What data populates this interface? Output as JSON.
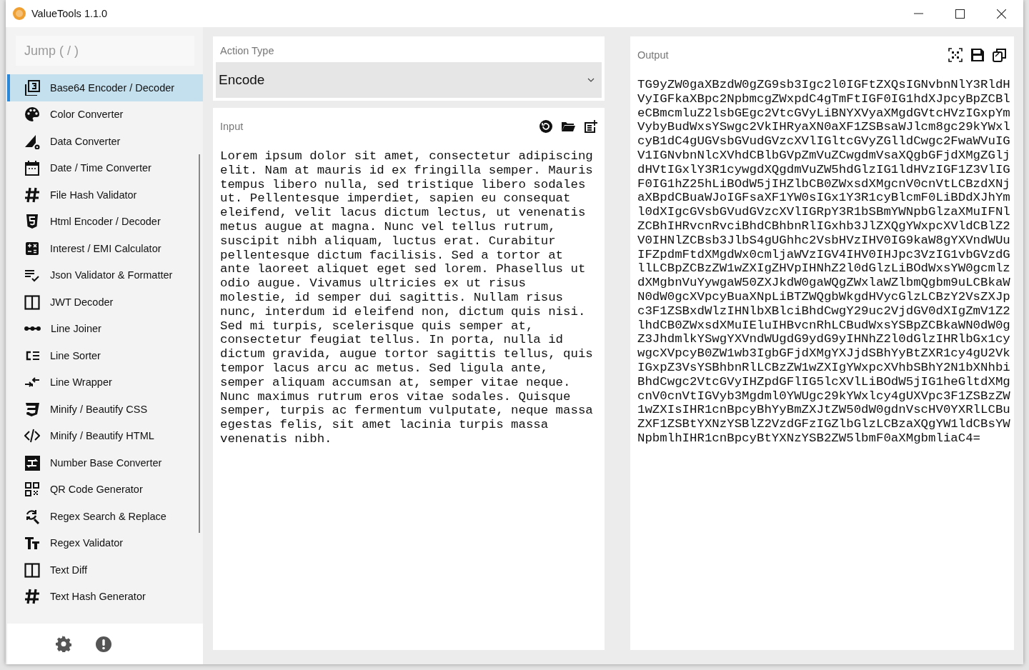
{
  "window": {
    "title": "ValueTools 1.1.0"
  },
  "sidebar": {
    "search_placeholder": "Jump ( / )",
    "items": [
      {
        "label": "Base64 Encoder / Decoder",
        "selected": true
      },
      {
        "label": "Color Converter",
        "selected": false
      },
      {
        "label": "Data Converter",
        "selected": false
      },
      {
        "label": "Date / Time Converter",
        "selected": false
      },
      {
        "label": "File Hash Validator",
        "selected": false
      },
      {
        "label": "Html Encoder / Decoder",
        "selected": false
      },
      {
        "label": "Interest / EMI Calculator",
        "selected": false
      },
      {
        "label": "Json Validator & Formatter",
        "selected": false
      },
      {
        "label": "JWT Decoder",
        "selected": false
      },
      {
        "label": "Line Joiner",
        "selected": false
      },
      {
        "label": "Line Sorter",
        "selected": false
      },
      {
        "label": "Line Wrapper",
        "selected": false
      },
      {
        "label": "Minify / Beautify CSS",
        "selected": false
      },
      {
        "label": "Minify / Beautify HTML",
        "selected": false
      },
      {
        "label": "Number Base Converter",
        "selected": false
      },
      {
        "label": "QR Code Generator",
        "selected": false
      },
      {
        "label": "Regex Search & Replace",
        "selected": false
      },
      {
        "label": "Regex Validator",
        "selected": false
      },
      {
        "label": "Text Diff",
        "selected": false
      },
      {
        "label": "Text Hash Generator",
        "selected": false
      }
    ]
  },
  "action_type": {
    "label": "Action Type",
    "value": "Encode"
  },
  "input": {
    "label": "Input",
    "lines": [
      "Lorem ipsum dolor sit amet, consectetur adipiscing",
      "elit. Nam at mauris id ex fringilla semper. Mauris",
      "tempus libero nulla, sed tristique libero sodales",
      "ut. Pellentesque imperdiet, sapien eu consequat",
      "eleifend, velit lacus dictum lectus, ut venenatis",
      "metus augue at magna. Nunc vel tellus rutrum,",
      "suscipit nibh aliquam, luctus erat. Curabitur",
      "pellentesque dictum facilisis. Sed a tortor at",
      "ante laoreet aliquet eget sed lorem. Phasellus ut",
      "odio augue. Vivamus ultricies ex ut risus",
      "molestie, id semper dui sagittis. Nullam risus",
      "nunc, interdum id eleifend non, dictum quis nisi.",
      "Sed mi turpis, scelerisque quis semper at,",
      "consectetur feugiat tellus. In porta, nulla id",
      "dictum gravida, augue tortor sagittis tellus, quis",
      "tempor lacus arcu ac metus. Sed ligula ante,",
      "semper aliquam accumsan at, semper vitae neque.",
      "Nunc maximus rutrum eros vitae sodales. Quisque",
      "semper, turpis ac fermentum vulputate, neque massa",
      "egestas felis, sit amet lacinia turpis massa",
      "venenatis nibh."
    ]
  },
  "output": {
    "label": "Output",
    "lines": [
      "TG9yZW0gaXBzdW0gZG9sb3Igc2l0IGFtZXQsIGNvbnNlY3RldH",
      "VyIGFkaXBpc2NpbmcgZWxpdC4gTmFtIGF0IG1hdXJpcyBpZCBl",
      "eCBmcmluZ2lsbGEgc2VtcGVyLiBNYXVyaXMgdGVtcHVzIGxpYm",
      "VybyBudWxsYSwgc2VkIHRyaXN0aXF1ZSBsaWJlcm8gc29kYWxl",
      "cyB1dC4gUGVsbGVudGVzcXVlIGltcGVyZGlldCwgc2FwaWVuIG",
      "V1IGNvbnNlcXVhdCBlbGVpZmVuZCwgdmVsaXQgbGFjdXMgZGlj",
      "dHVtIGxlY3R1cywgdXQgdmVuZW5hdGlzIG1ldHVzIGF1Z3VlIG",
      "F0IG1hZ25hLiBOdW5jIHZlbCB0ZWxsdXMgcnV0cnVtLCBzdXNj",
      "aXBpdCBuaWJoIGFsaXF1YW0sIGx1Y3R1cyBlcmF0LiBDdXJhYm",
      "l0dXIgcGVsbGVudGVzcXVlIGRpY3R1bSBmYWNpbGlzaXMuIFNl",
      "ZCBhIHRvcnRvciBhdCBhbnRlIGxhb3JlZXQgYWxpcXVldCBlZ2",
      "V0IHNlZCBsb3JlbS4gUGhhc2VsbHVzIHV0IG9kaW8gYXVndWUu",
      "IFZpdmFtdXMgdWx0cmljaWVzIGV4IHV0IHJpc3VzIG1vbGVzdG",
      "llLCBpZCBzZW1wZXIgZHVpIHNhZ2l0dGlzLiBOdWxsYW0gcmlz",
      "dXMgbnVuYywgaW50ZXJkdW0gaWQgZWxlaWZlbmQgbm9uLCBkaW",
      "N0dW0gcXVpcyBuaXNpLiBTZWQgbWkgdHVycGlzLCBzY2VsZXJp",
      "c3F1ZSBxdWlzIHNlbXBlciBhdCwgY29uc2VjdGV0dXIgZmV1Z2",
      "lhdCB0ZWxsdXMuIEluIHBvcnRhLCBudWxsYSBpZCBkaWN0dW0g",
      "Z3JhdmlkYSwgYXVndWUgdG9ydG9yIHNhZ2l0dGlzIHRlbGx1cy",
      "wgcXVpcyB0ZW1wb3IgbGFjdXMgYXJjdSBhYyBtZXR1cy4gU2Vk",
      "IGxpZ3VsYSBhbnRlLCBzZW1wZXIgYWxpcXVhbSBhY2N1bXNhbi",
      "BhdCwgc2VtcGVyIHZpdGFlIG5lcXVlLiBOdW5jIG1heGltdXMg",
      "cnV0cnVtIGVyb3Mgdml0YWUgc29kYWxlcy4gUXVpc3F1ZSBzZW",
      "1wZXIsIHR1cnBpcyBhYyBmZXJtZW50dW0gdnVscHV0YXRlLCBu",
      "ZXF1ZSBtYXNzYSBlZ2VzdGFzIGZlbGlzLCBzaXQgYW1ldCBsYW",
      "NpbmlhIHR1cnBpcyBtYXNzYSB2ZW5lbmF0aXMgbmliaC4="
    ]
  }
}
